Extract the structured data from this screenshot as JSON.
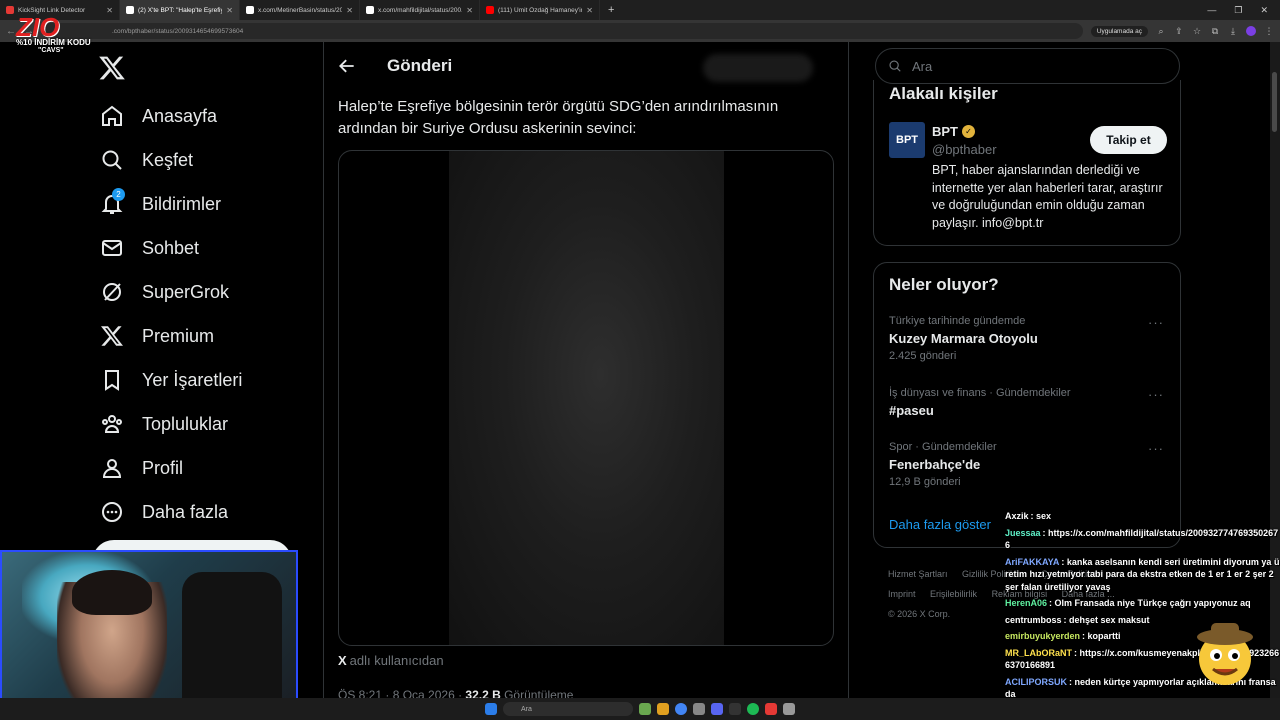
{
  "browser": {
    "tabs": [
      {
        "title": "KickSight Link Detector",
        "fav": "#e53935"
      },
      {
        "title": "(2) X'te BPT: \"Halep'te Eşrefiye...",
        "fav": "#ffffff"
      },
      {
        "title": "x.com/MetinerBasin/status/200...",
        "fav": "#ffffff"
      },
      {
        "title": "x.com/mahfildijital/status/200...",
        "fav": "#ffffff"
      },
      {
        "title": "(111) Ümit Özdağ Hamaney'in...",
        "fav": "#ff0000"
      }
    ],
    "url": ".com/bpthaber/status/2009314654699573604",
    "open_in_app": "Uygulamada aç"
  },
  "watermark": {
    "logo": "ZIO",
    "line": "%10 İNDİRİM KODU",
    "code": "\"CAVS\""
  },
  "nav": {
    "items": [
      {
        "label": "Anasayfa",
        "icon": "home-icon"
      },
      {
        "label": "Keşfet",
        "icon": "search-icon"
      },
      {
        "label": "Bildirimler",
        "icon": "bell-icon",
        "badge": "2"
      },
      {
        "label": "Sohbet",
        "icon": "mail-icon"
      },
      {
        "label": "SuperGrok",
        "icon": "grok-icon"
      },
      {
        "label": "Premium",
        "icon": "x-premium-icon"
      },
      {
        "label": "Yer İşaretleri",
        "icon": "bookmark-icon"
      },
      {
        "label": "Topluluklar",
        "icon": "communities-icon"
      },
      {
        "label": "Profil",
        "icon": "profile-icon"
      },
      {
        "label": "Daha fazla",
        "icon": "more-circle-icon"
      }
    ]
  },
  "main": {
    "title": "Gönderi",
    "post_text": "Halep’te Eşrefiye bölgesinin terör örgütü SDG’den arındırılmasının ardından bir Suriye Ordusu askerinin sevinci:",
    "source_brand": "X",
    "source_text": "adlı kullanıcıdan",
    "meta_time": "ÖS 8:21 · 8 Oca 2026 · ",
    "meta_views_count": "32,2 B",
    "meta_views_label": " Görüntüleme"
  },
  "right": {
    "search_placeholder": "Ara",
    "related_title": "Alakalı kişiler",
    "account": {
      "logo_text": "BPT",
      "name": "BPT",
      "handle": "@bpthaber",
      "follow_label": "Takip et",
      "bio": "BPT, haber ajanslarından derlediği ve internette yer alan haberleri tarar, araştırır ve doğruluğundan emin olduğu zaman paylaşır. info@bpt.tr"
    },
    "trends_title": "Neler oluyor?",
    "trends": [
      {
        "context": "Türkiye tarihinde gündemde",
        "name": "Kuzey Marmara Otoyolu",
        "count": "2.425 gönderi"
      },
      {
        "context": "İş dünyası ve finans · Gündemdekiler",
        "name": "#paseu",
        "count": ""
      },
      {
        "context": "Spor · Gündemdekiler",
        "name": "Fenerbahçe'de",
        "count": "12,9 B gönderi"
      }
    ],
    "show_more": "Daha fazla göster",
    "footer": {
      "row1": [
        "Hizmet Şartları",
        "Gizlilik Politikası",
        "Çerez Politikası"
      ],
      "row2": [
        "Imprint",
        "Erişilebilirlik",
        "Reklam bilgisi",
        "Daha fazla ..."
      ],
      "copyright": "© 2026 X Corp."
    }
  },
  "chat": [
    {
      "user": "Axzik",
      "color": "#ffffff",
      "text": "sex"
    },
    {
      "user": "Juessaa",
      "color": "#5ff0c8",
      "text": "https://x.com/mahfildijital/status/2009327747693502676"
    },
    {
      "user": "AriFAKKAYA",
      "color": "#7fa8ff",
      "text": "kanka aselsanın kendi seri üretimini diyorum ya üretim hızı yetmiyor tabi para da ekstra etken de 1 er 1 er 2 şer 2 şer falan üretiliyor yavaş"
    },
    {
      "user": "HerenA06",
      "color": "#5ff0a0",
      "text": "Olm Fransada niye Türkçe çağrı yapıyonuz aq"
    },
    {
      "user": "centrumboss",
      "color": "#ffffff",
      "text": "dehşet sex maksut"
    },
    {
      "user": "emirbuyukyerden",
      "color": "#c7e860",
      "text": "kopartti"
    },
    {
      "user": "MR_LAbORaNT",
      "color": "#ffe14d",
      "text": "https://x.com/kusmeyenakpli/status/2009232666370166891"
    },
    {
      "user": "ACILIPORSUK",
      "color": "#7fa8ff",
      "text": "neden kürtçe yapmıyorlar açıklamalarını fransada"
    }
  ],
  "taskbar": {
    "search": "Ara"
  }
}
